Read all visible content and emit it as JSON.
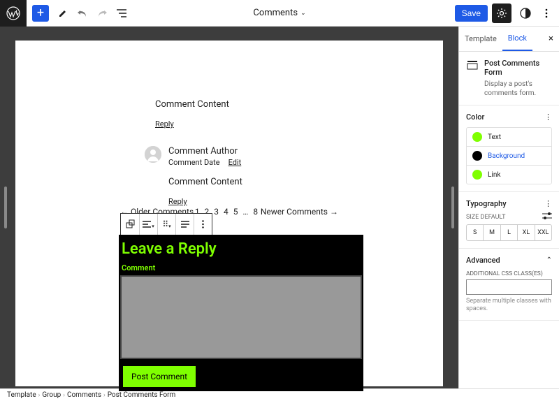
{
  "header": {
    "doc_title": "Comments",
    "save_label": "Save"
  },
  "canvas": {
    "c1": {
      "content": "Comment Content",
      "reply": "Reply"
    },
    "c2": {
      "author": "Comment Author",
      "date": "Comment Date",
      "edit": "Edit",
      "content": "Comment Content",
      "reply": "Reply"
    },
    "pager": {
      "older": "Older Comments",
      "newer": "Newer Comments",
      "nums": "1 2 3 4 5 … 8"
    },
    "form": {
      "title": "Leave a Reply",
      "label_comment": "Comment",
      "submit": "Post Comment"
    }
  },
  "sidebar": {
    "tab_template": "Template",
    "tab_block": "Block",
    "block_name": "Post Comments Form",
    "block_desc": "Display a post's comments form.",
    "color_title": "Color",
    "color_text": "Text",
    "color_bg": "Background",
    "color_link": "Link",
    "typo_title": "Typography",
    "size_label": "SIZE",
    "size_default": "DEFAULT",
    "sizes": {
      "s": "S",
      "m": "M",
      "l": "L",
      "xl": "XL",
      "xxl": "XXL"
    },
    "adv_title": "Advanced",
    "css_label": "ADDITIONAL CSS CLASS(ES)",
    "css_help": "Separate multiple classes with spaces."
  },
  "breadcrumb": {
    "b1": "Template",
    "b2": "Group",
    "b3": "Comments",
    "b4": "Post Comments Form"
  }
}
